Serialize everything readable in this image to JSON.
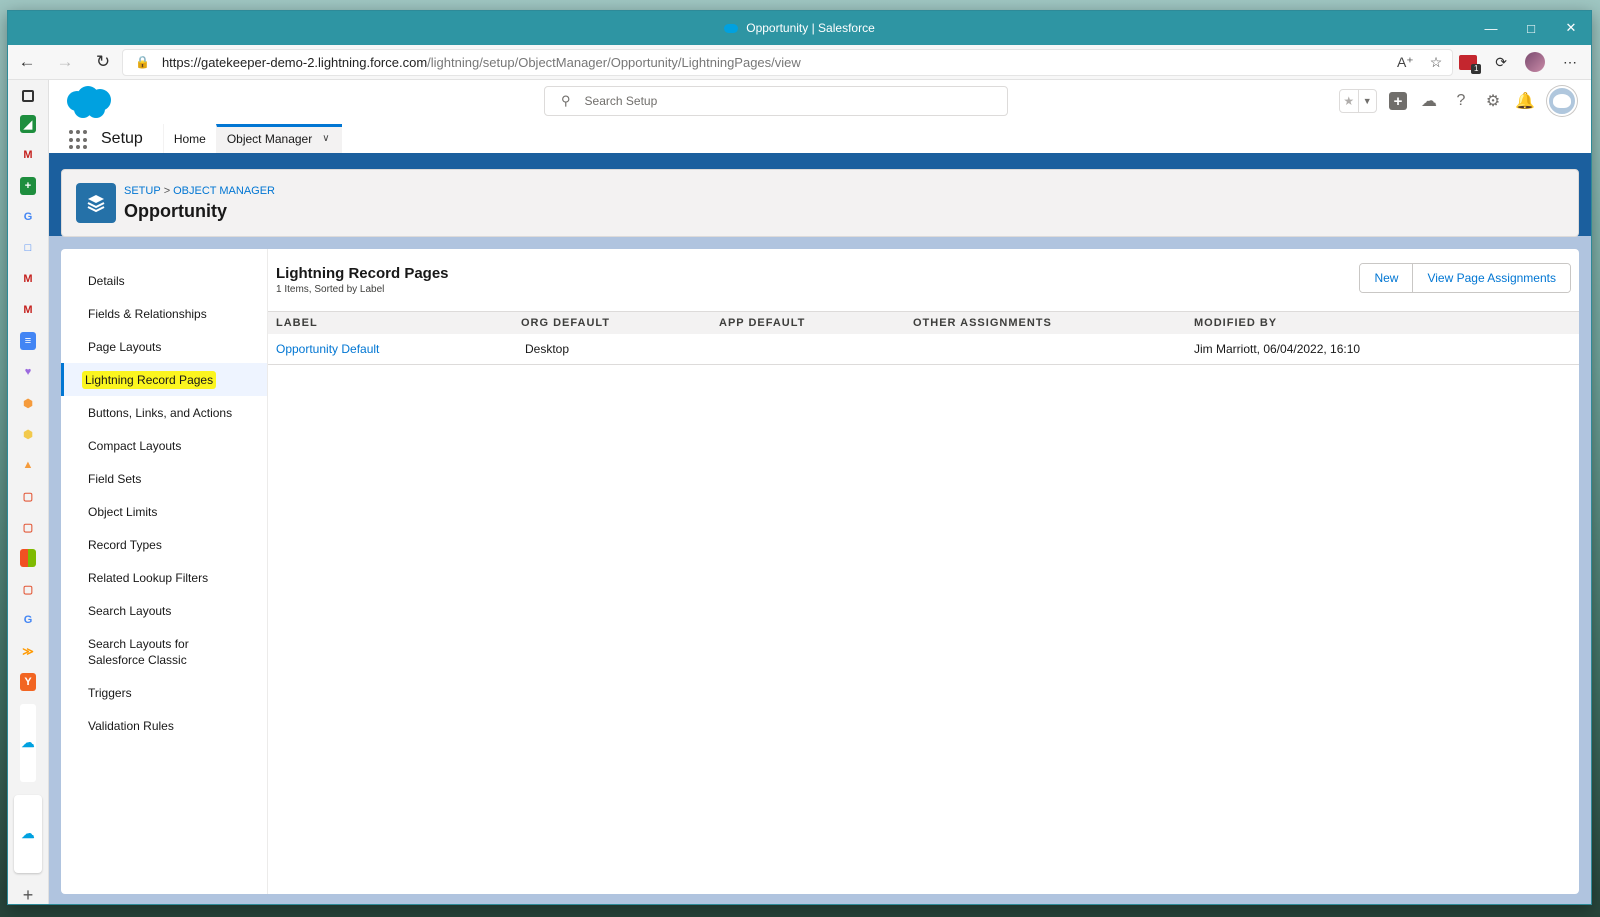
{
  "window": {
    "title": "Opportunity | Salesforce"
  },
  "browser": {
    "url_host": "https://gatekeeper-demo-2.lightning.force.com",
    "url_path": "/lightning/setup/ObjectManager/Opportunity/LightningPages/view"
  },
  "salesforce": {
    "search_placeholder": "Search Setup",
    "app_name": "Setup",
    "tabs": [
      {
        "label": "Home"
      },
      {
        "label": "Object Manager"
      }
    ]
  },
  "page_header": {
    "breadcrumb": [
      "SETUP",
      "OBJECT MANAGER"
    ],
    "breadcrumb_sep": ">",
    "title": "Opportunity"
  },
  "left_nav": {
    "items": [
      {
        "label": "Details"
      },
      {
        "label": "Fields & Relationships"
      },
      {
        "label": "Page Layouts"
      },
      {
        "label": "Lightning Record Pages"
      },
      {
        "label": "Buttons, Links, and Actions"
      },
      {
        "label": "Compact Layouts"
      },
      {
        "label": "Field Sets"
      },
      {
        "label": "Object Limits"
      },
      {
        "label": "Record Types"
      },
      {
        "label": "Related Lookup Filters"
      },
      {
        "label": "Search Layouts"
      },
      {
        "label": "Search Layouts for Salesforce Classic"
      },
      {
        "label": "Triggers"
      },
      {
        "label": "Validation Rules"
      }
    ],
    "active_index": 3
  },
  "list": {
    "title": "Lightning Record Pages",
    "subtitle": "1 Items, Sorted by Label",
    "buttons": {
      "new": "New",
      "view_assignments": "View Page Assignments"
    },
    "columns": [
      "LABEL",
      "ORG DEFAULT",
      "APP DEFAULT",
      "OTHER ASSIGNMENTS",
      "MODIFIED BY"
    ],
    "rows": [
      {
        "label": "Opportunity Default",
        "org_default": "Desktop",
        "app_default": "",
        "other_assignments": "",
        "modified_by": "Jim Marriott, 06/04/2022, 16:10"
      }
    ]
  },
  "colors": {
    "brand": "#0176d3",
    "header_band": "#1b5f9e",
    "highlight": "#fbf51f"
  }
}
